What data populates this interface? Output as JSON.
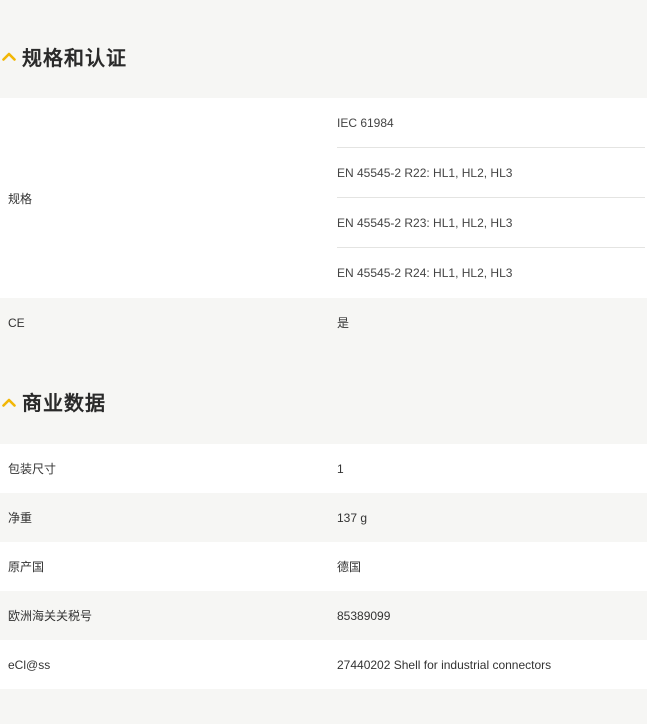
{
  "sections": [
    {
      "title": "规格和认证",
      "rows": [
        {
          "label": "规格",
          "values": [
            "IEC 61984",
            "EN 45545-2 R22: HL1, HL2, HL3",
            "EN 45545-2 R23: HL1, HL2, HL3",
            "EN 45545-2 R24: HL1, HL2, HL3"
          ]
        },
        {
          "label": "CE",
          "value": "是"
        }
      ]
    },
    {
      "title": "商业数据",
      "rows": [
        {
          "label": "包装尺寸",
          "value": "1"
        },
        {
          "label": "净重",
          "value": "137 g"
        },
        {
          "label": "原产国",
          "value": "德国"
        },
        {
          "label": "欧洲海关关税号",
          "value": "85389099"
        },
        {
          "label": "eCl@ss",
          "value": "27440202 Shell for industrial connectors"
        }
      ]
    }
  ],
  "colors": {
    "accent": "#f2b705",
    "row_alt": "#f6f6f4",
    "row": "#ffffff"
  },
  "icons": {
    "collapse": "chevron-up-icon"
  }
}
